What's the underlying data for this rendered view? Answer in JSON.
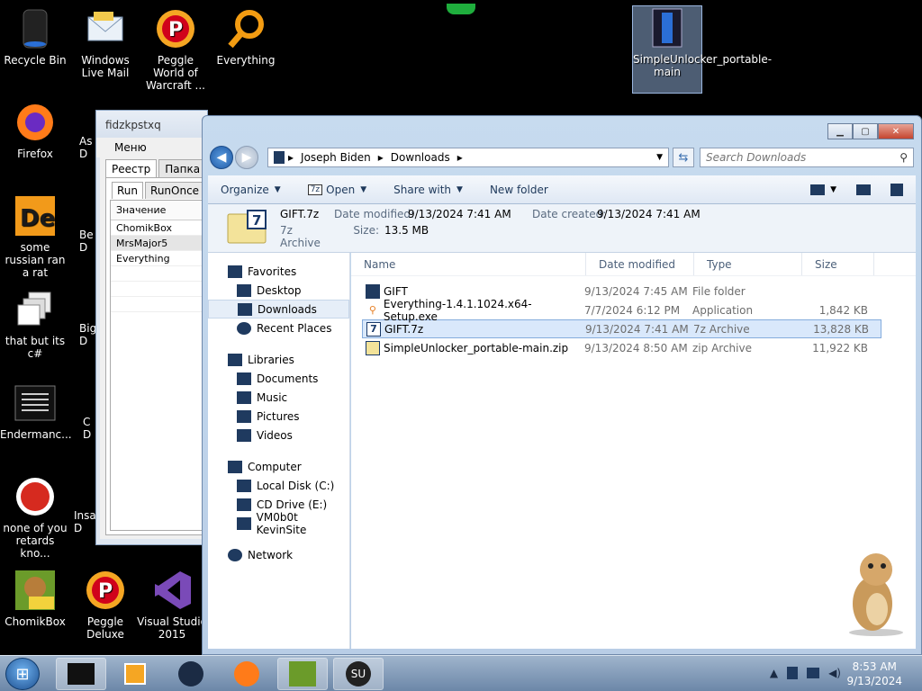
{
  "desktop": {
    "icons": [
      {
        "label": "Recycle Bin"
      },
      {
        "label": "Windows Live Mail"
      },
      {
        "label": "Peggle World of Warcraft ..."
      },
      {
        "label": "Everything"
      },
      {
        "label": "SimpleUnlocker_portable-main"
      },
      {
        "label": "Firefox"
      },
      {
        "label": "some russian ran a rat"
      },
      {
        "label": "that but its c#"
      },
      {
        "label": "Endermanc..."
      },
      {
        "label": "none of you retards kno..."
      },
      {
        "label": "ChomikBox"
      },
      {
        "label": "Peggle Deluxe"
      },
      {
        "label": "Visual Studio 2015"
      },
      {
        "label": "As D"
      },
      {
        "label": "Be D"
      },
      {
        "label": "Big D"
      },
      {
        "label": "C D"
      },
      {
        "label": "Insa D"
      }
    ]
  },
  "registry_window": {
    "title": "fidzkpstxq",
    "menu": "Меню",
    "tabs": [
      "Реестр",
      "Папка авто"
    ],
    "subtabs": [
      "Run",
      "RunOnce"
    ],
    "column_header": "Значение",
    "rows": [
      "ChomikBox",
      "MrsMajor5",
      "Everything"
    ]
  },
  "explorer": {
    "breadcrumb": [
      "Joseph Biden",
      "Downloads"
    ],
    "search_placeholder": "Search Downloads",
    "toolbar": {
      "organize": "Organize",
      "open": "Open",
      "share": "Share with",
      "new_folder": "New folder"
    },
    "details": {
      "name": "GIFT.7z",
      "type": "7z Archive",
      "modified_label": "Date modified:",
      "modified": "9/13/2024 7:41 AM",
      "created_label": "Date created:",
      "created": "9/13/2024 7:41 AM",
      "size_label": "Size:",
      "size": "13.5 MB"
    },
    "nav": {
      "favorites": "Favorites",
      "desktop": "Desktop",
      "downloads": "Downloads",
      "recent": "Recent Places",
      "libraries": "Libraries",
      "documents": "Documents",
      "music": "Music",
      "pictures": "Pictures",
      "videos": "Videos",
      "computer": "Computer",
      "local_disk": "Local Disk (C:)",
      "cd_drive": "CD Drive (E:)",
      "vm_share": "VM0b0t KevinSite",
      "network": "Network"
    },
    "columns": {
      "name": "Name",
      "date": "Date modified",
      "type": "Type",
      "size": "Size"
    },
    "files": [
      {
        "name": "GIFT",
        "date": "9/13/2024 7:45 AM",
        "type": "File folder",
        "size": ""
      },
      {
        "name": "Everything-1.4.1.1024.x64-Setup.exe",
        "date": "7/7/2024 6:12 PM",
        "type": "Application",
        "size": "1,842 KB"
      },
      {
        "name": "GIFT.7z",
        "date": "9/13/2024 7:41 AM",
        "type": "7z Archive",
        "size": "13,828 KB"
      },
      {
        "name": "SimpleUnlocker_portable-main.zip",
        "date": "9/13/2024 8:50 AM",
        "type": "zip Archive",
        "size": "11,922 KB"
      }
    ]
  },
  "taskbar": {
    "time": "8:53 AM",
    "date": "9/13/2024"
  },
  "colors": {
    "desktop_bg": "#000000",
    "selection": "#d9e8fb",
    "window_frame": "#c7dbef"
  }
}
